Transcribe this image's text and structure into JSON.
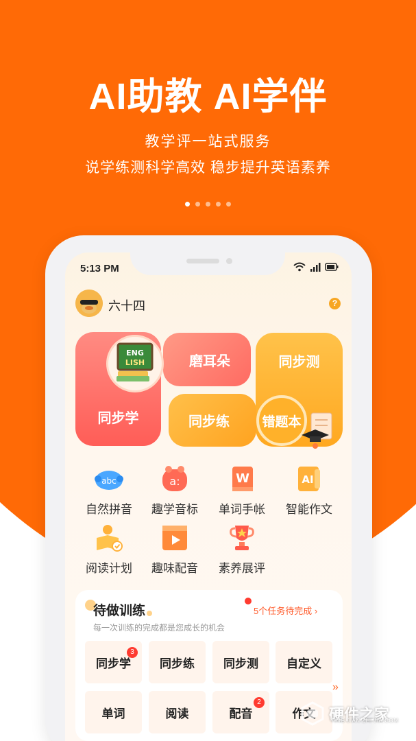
{
  "hero": {
    "headline": "AI助教 AI学伴",
    "line1": "教学评一站式服务",
    "line2": "说学练测科学高效  稳步提升英语素养",
    "carousel_pages": 5,
    "active_page": 1
  },
  "status_bar": {
    "time": "5:13 PM"
  },
  "profile": {
    "username": "六十四"
  },
  "feature_tiles": {
    "tongbuxue": "同步学",
    "moerduo": "磨耳朵",
    "tongbuce": "同步测",
    "tongbulian": "同步练",
    "cuotiben": "错题本",
    "english_badge": "ENGLISH"
  },
  "tools": [
    {
      "label": "自然拼音",
      "icon": "abc-icon"
    },
    {
      "label": "趣学音标",
      "icon": "phonetic-icon"
    },
    {
      "label": "单词手帐",
      "icon": "word-book-icon"
    },
    {
      "label": "智能作文",
      "icon": "ai-writing-icon"
    },
    {
      "label": "阅读计划",
      "icon": "reading-plan-icon"
    },
    {
      "label": "趣味配音",
      "icon": "video-dubbing-icon"
    },
    {
      "label": "素养展评",
      "icon": "trophy-icon"
    }
  ],
  "tasks": {
    "title": "待做训练",
    "subtitle": "每一次训练的完成都是您成长的机会",
    "pending_link": "5个任务待完成",
    "buttons": [
      {
        "label": "同步学",
        "badge": "3"
      },
      {
        "label": "同步练",
        "badge": ""
      },
      {
        "label": "同步测",
        "badge": ""
      },
      {
        "label": "自定义",
        "badge": ""
      },
      {
        "label": "单词",
        "badge": ""
      },
      {
        "label": "阅读",
        "badge": ""
      },
      {
        "label": "配音",
        "badge": "2"
      },
      {
        "label": "作文",
        "badge": ""
      }
    ]
  },
  "watermark": {
    "text": "硬件之家",
    "sub": "YING JIAN ZHI JIA.COM"
  },
  "colors": {
    "brand_orange": "#ff6a06",
    "tile_red": "#ff5d57",
    "tile_yellow": "#ffa820",
    "badge_red": "#ff3b30"
  }
}
